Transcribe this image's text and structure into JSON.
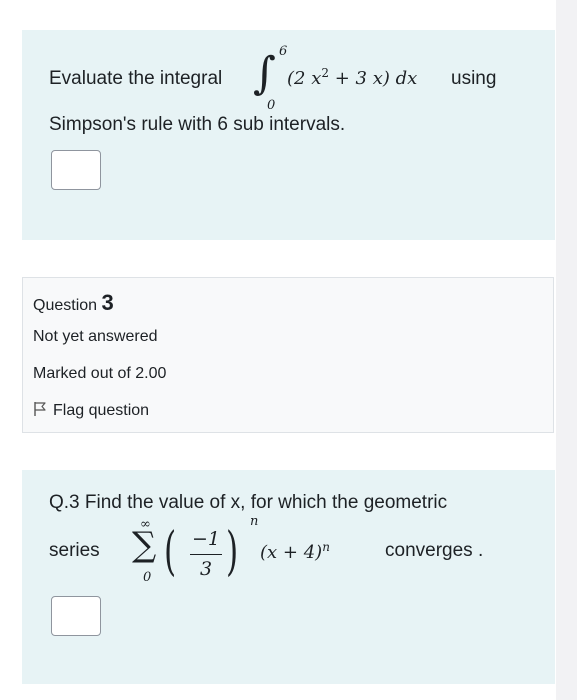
{
  "question2": {
    "text_before": "Evaluate the integral",
    "integral": {
      "upper": "6",
      "lower": "0",
      "integrand": "(2 x",
      "exponent": "2",
      "integrand_rest": " + 3 x) dx"
    },
    "text_after": "using",
    "line2": "Simpson's rule with 6 sub intervals.",
    "answer_value": ""
  },
  "question3_info": {
    "label": "Question",
    "number": "3",
    "status": "Not yet answered",
    "marks": "Marked out of 2.00",
    "flag_label": "Flag question"
  },
  "question3": {
    "line1": "Q.3  Find the value of x,  for which the  geometric",
    "series_label": "series",
    "sum_upper": "∞",
    "sum_lower": "0",
    "frac_num": "−1",
    "frac_den": "3",
    "power": "n",
    "factor": "(x + 4)",
    "factor_power": "n",
    "text_after": "converges .",
    "answer_value": ""
  },
  "colors": {
    "question_bg": "#e7f3f5",
    "info_bg": "#f8f9fa",
    "page_bg": "#ffffff"
  }
}
